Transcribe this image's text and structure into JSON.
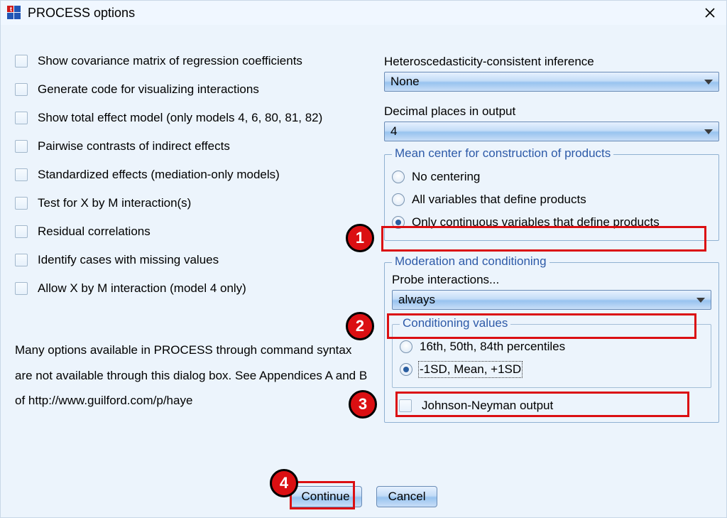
{
  "window": {
    "title": "PROCESS options"
  },
  "left": {
    "checks": [
      "Show covariance matrix of regression coefficients",
      "Generate code for visualizing interactions",
      "Show total effect model (only models 4, 6, 80, 81, 82)",
      "Pairwise contrasts of indirect effects",
      "Standardized effects (mediation-only models)",
      "Test for X by M interaction(s)",
      "Residual correlations",
      "Identify cases with missing values",
      "Allow X by M interaction (model 4 only)"
    ],
    "note": "Many options available in PROCESS through command syntax are not available through this dialog box.  See Appendices A and B of http://www.guilford.com/p/haye"
  },
  "right": {
    "hc_label": "Heteroscedasticity-consistent inference",
    "hc_value": "None",
    "dec_label": "Decimal places in output",
    "dec_value": "4",
    "mc": {
      "legend": "Mean center for construction of products",
      "opt1": "No centering",
      "opt2": "All variables that define products",
      "opt3": "Only continuous variables that define products"
    },
    "mod": {
      "legend": "Moderation and conditioning",
      "probe_label": "Probe interactions...",
      "probe_value": "always",
      "cond_legend": "Conditioning values",
      "cond1": "16th, 50th, 84th percentiles",
      "cond2": "-1SD, Mean, +1SD",
      "jn": "Johnson-Neyman output"
    }
  },
  "buttons": {
    "continue": "Continue",
    "cancel": "Cancel"
  },
  "steps": {
    "s1": "1",
    "s2": "2",
    "s3": "3",
    "s4": "4"
  }
}
